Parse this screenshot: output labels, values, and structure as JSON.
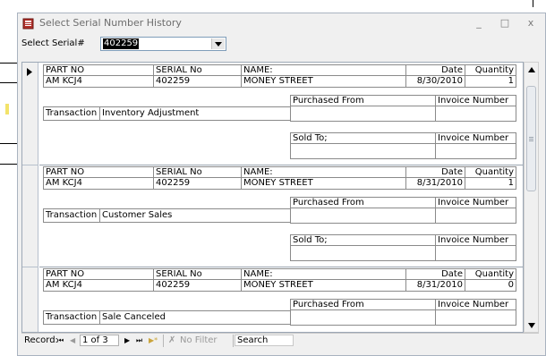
{
  "window": {
    "title": "Select Serial Number History",
    "min_glyph": "_",
    "max_glyph": "□",
    "close_glyph": "x"
  },
  "filter": {
    "label": "Select Serial#",
    "value": "402259"
  },
  "labels": {
    "part_no": "PART NO",
    "serial_no": "SERIAL No",
    "name": "NAME:",
    "date": "Date",
    "quantity": "Quantity",
    "transaction": "Transaction",
    "purchased_from": "Purchased From",
    "sold_to": "Sold To;",
    "invoice_number": "Invoice Number"
  },
  "records": [
    {
      "part_no": "AM KCJ4",
      "serial_no": "402259",
      "name": "MONEY STREET",
      "date": "8/30/2010",
      "quantity": "1",
      "transaction": "Inventory Adjustment",
      "purchased_from": "",
      "purchase_invoice": "",
      "sold_to": "",
      "sold_invoice": ""
    },
    {
      "part_no": "AM KCJ4",
      "serial_no": "402259",
      "name": "MONEY STREET",
      "date": "8/31/2010",
      "quantity": "1",
      "transaction": "Customer Sales",
      "purchased_from": "",
      "purchase_invoice": "",
      "sold_to": "",
      "sold_invoice": ""
    },
    {
      "part_no": "AM KCJ4",
      "serial_no": "402259",
      "name": "MONEY STREET",
      "date": "8/31/2010",
      "quantity": "0",
      "transaction": "Sale Canceled",
      "purchased_from": "",
      "purchase_invoice": "",
      "sold_to": "",
      "sold_invoice": ""
    }
  ],
  "nav": {
    "record_label": "Record:",
    "current": "1 of 3",
    "first_glyph": "⏮",
    "prev_glyph": "◀",
    "next_glyph": "▶",
    "last_glyph": "⏭",
    "new_glyph": "▶*",
    "filter_icon": "✗",
    "filter_label": "No Filter",
    "search_label": "Search"
  },
  "colors": {
    "window_bg": "#f0f0f0",
    "selected_text_bg": "#000000",
    "border": "#8a8a8a"
  }
}
